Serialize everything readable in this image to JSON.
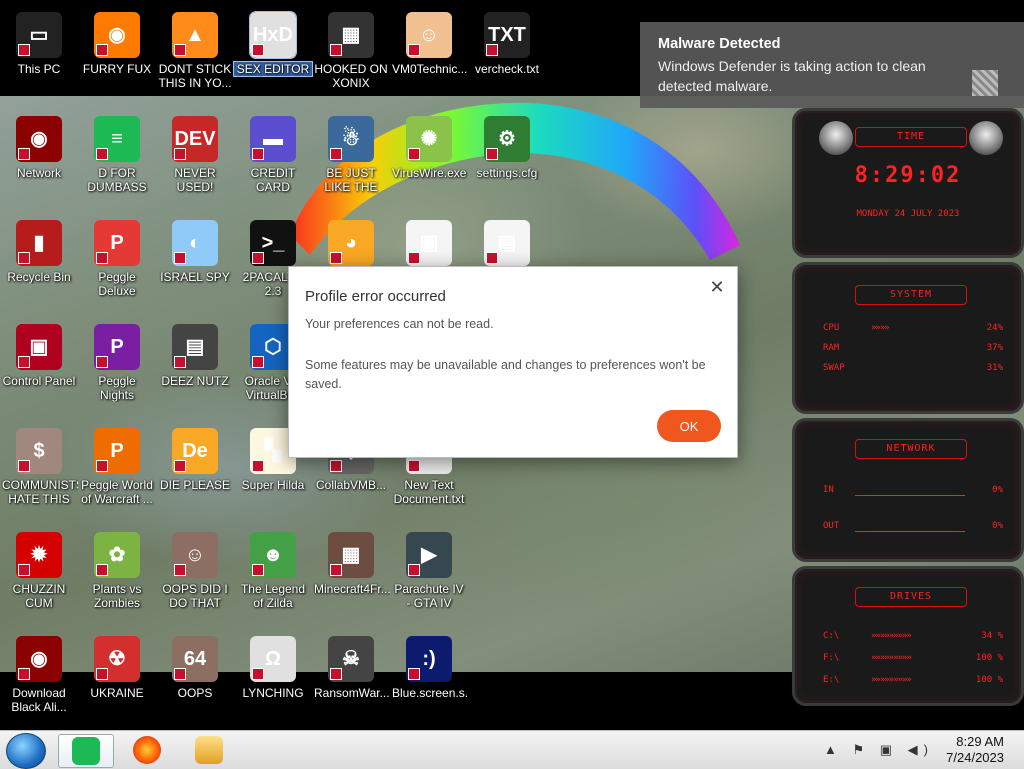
{
  "desktop_icons": [
    {
      "id": "this-pc",
      "label": "This PC",
      "color": "#222",
      "glyph": "▭"
    },
    {
      "id": "furry-fux",
      "label": "FURRY FUX",
      "color": "#ff7a00",
      "glyph": "◉"
    },
    {
      "id": "dont-stick",
      "label": "DONT STICK THIS IN YO...",
      "color": "#ff8c1a",
      "glyph": "▲"
    },
    {
      "id": "sex-editor",
      "label": "SEX EDITOR",
      "color": "#e0e0e0",
      "glyph": "HxD"
    },
    {
      "id": "hooked-on-xonix",
      "label": "HOOKED ON XONIX",
      "color": "#333",
      "glyph": "▦"
    },
    {
      "id": "vm0technic",
      "label": "VM0Technic...",
      "color": "#f0c090",
      "glyph": "☺"
    },
    {
      "id": "vercheck",
      "label": "vercheck.txt",
      "color": "#222",
      "glyph": "TXT"
    },
    {
      "id": "network",
      "label": "Network",
      "color": "#8b0000",
      "glyph": "◉"
    },
    {
      "id": "d-for-dumbass",
      "label": "D FOR DUMBASS",
      "color": "#1db954",
      "glyph": "≡"
    },
    {
      "id": "never-used",
      "label": "NEVER USED!",
      "color": "#c62828",
      "glyph": "DEV"
    },
    {
      "id": "credit-card",
      "label": "CREDIT CARD CHECKER",
      "color": "#5c4ecf",
      "glyph": "▬"
    },
    {
      "id": "be-just-like",
      "label": "BE JUST LIKE THE DUDE!",
      "color": "#3b6a9a",
      "glyph": "☃"
    },
    {
      "id": "viruswire",
      "label": "VirusWire.exe",
      "color": "#8bc34a",
      "glyph": "✺"
    },
    {
      "id": "settings-cfg",
      "label": "settings.cfg",
      "color": "#2e7d32",
      "glyph": "⚙"
    },
    {
      "id": "recycle-bin",
      "label": "Recycle Bin",
      "color": "#b71c1c",
      "glyph": "▮"
    },
    {
      "id": "peggle-deluxe",
      "label": "Peggle Deluxe",
      "color": "#e53935",
      "glyph": "P"
    },
    {
      "id": "israel-spy",
      "label": "ISRAEL SPY",
      "color": "#90caf9",
      "glyph": "◐"
    },
    {
      "id": "2pacalypse",
      "label": "2PACALY... 2.3",
      "color": "#111",
      "glyph": ">_"
    },
    {
      "id": "dog",
      "label": "",
      "color": "#f9a825",
      "glyph": "◕"
    },
    {
      "id": "file-a",
      "label": "",
      "color": "#f5f5f5",
      "glyph": "▣"
    },
    {
      "id": "file-b",
      "label": "",
      "color": "#f5f5f5",
      "glyph": "▤"
    },
    {
      "id": "control-panel",
      "label": "Control Panel",
      "color": "#b00020",
      "glyph": "▣"
    },
    {
      "id": "peggle-nights",
      "label": "Peggle Nights Deluxe",
      "color": "#7b1fa2",
      "glyph": "P"
    },
    {
      "id": "deez-nutz",
      "label": "DEEZ NUTZ",
      "color": "#444",
      "glyph": "▤"
    },
    {
      "id": "oracle-vm",
      "label": "Oracle VM VirtualBox",
      "color": "#1565c0",
      "glyph": "⬡"
    },
    {
      "id": "communists",
      "label": "COMMUNISTS HATE THIS G...",
      "color": "#a1887f",
      "glyph": "$"
    },
    {
      "id": "peggle-world",
      "label": "Peggle World of Warcraft ...",
      "color": "#ef6c00",
      "glyph": "P"
    },
    {
      "id": "die-please",
      "label": "DIE PLEASE",
      "color": "#f9a825",
      "glyph": "De"
    },
    {
      "id": "super-hilda",
      "label": "Super Hilda",
      "color": "#fff8e1",
      "glyph": "▚"
    },
    {
      "id": "collabvm",
      "label": "CollabVMB...",
      "color": "#666",
      "glyph": "◆"
    },
    {
      "id": "new-text-doc",
      "label": "New Text Document.txt",
      "color": "#eee",
      "glyph": "▭"
    },
    {
      "id": "chuzzin-cum",
      "label": "CHUZZIN CUM",
      "color": "#d50000",
      "glyph": "✹"
    },
    {
      "id": "plants-vs-zombies",
      "label": "Plants vs Zombies",
      "color": "#7cb342",
      "glyph": "✿"
    },
    {
      "id": "oops-did-i",
      "label": "OOPS DID I DO THAT",
      "color": "#8d6e63",
      "glyph": "☺"
    },
    {
      "id": "legend-of-zilda",
      "label": "The Legend of Zilda",
      "color": "#43a047",
      "glyph": "☻"
    },
    {
      "id": "minecraft4fr",
      "label": "Minecraft4Fr...",
      "color": "#6d4c41",
      "glyph": "▦"
    },
    {
      "id": "parachute-iv",
      "label": "Parachute IV - GTA IV Scrip...",
      "color": "#37474f",
      "glyph": "▶"
    },
    {
      "id": "download-black",
      "label": "Download Black Ali...",
      "color": "#8b0000",
      "glyph": "◉"
    },
    {
      "id": "ukraine",
      "label": "UKRAINE",
      "color": "#d32f2f",
      "glyph": "☢"
    },
    {
      "id": "oops",
      "label": "OOPS",
      "color": "#8d6e63",
      "glyph": "64"
    },
    {
      "id": "lynching",
      "label": "LYNCHING",
      "color": "#e0e0e0",
      "glyph": "Ω"
    },
    {
      "id": "ransomwar",
      "label": "RansomWar...",
      "color": "#444",
      "glyph": "☠"
    },
    {
      "id": "blue-screen",
      "label": "Blue.screen.s...",
      "color": "#0d1b6e",
      "glyph": ":)"
    }
  ],
  "dialog": {
    "title": "Profile error occurred",
    "line1": "Your preferences can not be read.",
    "line2": "Some features may be unavailable and changes to preferences won't be saved.",
    "ok": "OK",
    "close": "✕"
  },
  "toast": {
    "title": "Malware Detected",
    "body": "Windows Defender is taking action to clean detected malware."
  },
  "gadget": {
    "time_title": "TIME",
    "time": "8:29:02",
    "date": "MONDAY 24 JULY 2023",
    "system_title": "SYSTEM",
    "cpu_label": "CPU",
    "cpu_value": "24%",
    "ram_label": "RAM",
    "ram_value": "37%",
    "swap_label": "SWAP",
    "swap_value": "31%",
    "network_title": "NETWORK",
    "in_label": "IN",
    "in_value": "0%",
    "out_label": "OUT",
    "out_value": "0%",
    "drives_title": "DRIVES",
    "drives": [
      {
        "label": "C:\\",
        "value": "34 %"
      },
      {
        "label": "F:\\",
        "value": "100 %"
      },
      {
        "label": "E:\\",
        "value": "100 %"
      }
    ]
  },
  "taskbar": {
    "time": "8:29 AM",
    "date": "7/24/2023",
    "tray_icons": "▲ ⚑ ▣ ◀)"
  }
}
